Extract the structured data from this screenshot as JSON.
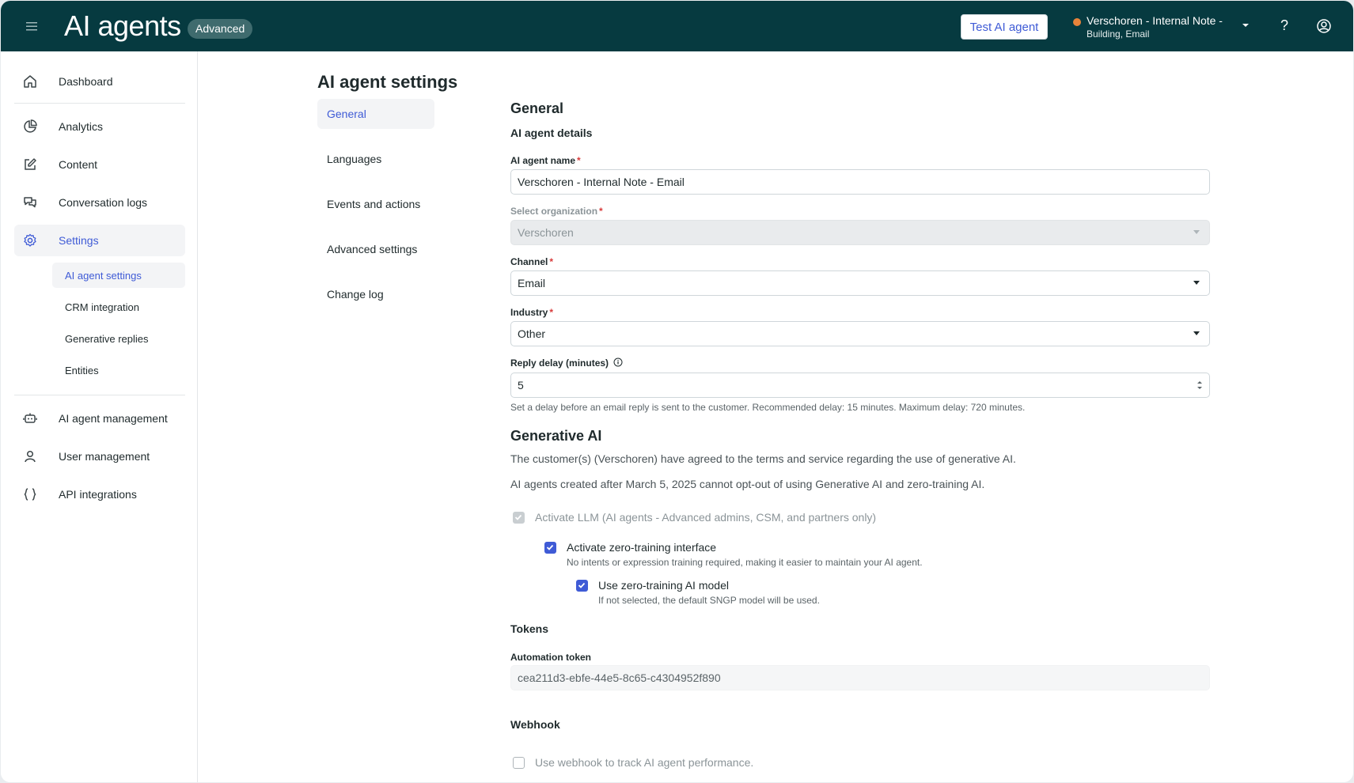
{
  "header": {
    "title": "AI agents",
    "badge": "Advanced",
    "test_button": "Test AI agent",
    "org_name": "Verschoren - Internal Note -",
    "org_sub": "Building, Email",
    "org_status_color": "#e8833a",
    "help_label": "?"
  },
  "sidebar": {
    "items": [
      {
        "label": "Dashboard",
        "icon": "home-icon"
      },
      {
        "label": "Analytics",
        "icon": "pie-chart-icon"
      },
      {
        "label": "Content",
        "icon": "edit-icon"
      },
      {
        "label": "Conversation logs",
        "icon": "chat-icon"
      },
      {
        "label": "Settings",
        "icon": "gear-icon"
      },
      {
        "label": "AI agent management",
        "icon": "robot-icon"
      },
      {
        "label": "User management",
        "icon": "user-icon"
      },
      {
        "label": "API integrations",
        "icon": "braces-icon"
      }
    ],
    "settings_sub": [
      "AI agent settings",
      "CRM integration",
      "Generative replies",
      "Entities"
    ]
  },
  "page": {
    "title": "AI agent settings",
    "subnav": [
      "General",
      "Languages",
      "Events and actions",
      "Advanced settings",
      "Change log"
    ]
  },
  "general": {
    "heading": "General",
    "details_heading": "AI agent details",
    "name_label": "AI agent name",
    "name_value": "Verschoren - Internal Note - Email",
    "org_label": "Select organization",
    "org_value": "Verschoren",
    "channel_label": "Channel",
    "channel_value": "Email",
    "industry_label": "Industry",
    "industry_value": "Other",
    "delay_label": "Reply delay (minutes)",
    "delay_value": "5",
    "delay_help": "Set a delay before an email reply is sent to the customer. Recommended delay: 15 minutes. Maximum delay: 720 minutes.",
    "required_mark": "*"
  },
  "genai": {
    "heading": "Generative AI",
    "text1": "The customer(s) (Verschoren) have agreed to the terms and service regarding the use of generative AI.",
    "text2": "AI agents created after March 5, 2025 cannot opt-out of using Generative AI and zero-training AI.",
    "llm_label": "Activate LLM (AI agents - Advanced admins, CSM, and partners only)",
    "zero_interface_label": "Activate zero-training interface",
    "zero_interface_desc": "No intents or expression training required, making it easier to maintain your AI agent.",
    "zero_model_label": "Use zero-training AI model",
    "zero_model_desc": "If not selected, the default SNGP model will be used."
  },
  "tokens": {
    "heading": "Tokens",
    "automation_label": "Automation token",
    "automation_value": "cea211d3-ebfe-44e5-8c65-c4304952f890"
  },
  "webhook": {
    "heading": "Webhook",
    "use_label": "Use webhook to track AI agent performance."
  }
}
